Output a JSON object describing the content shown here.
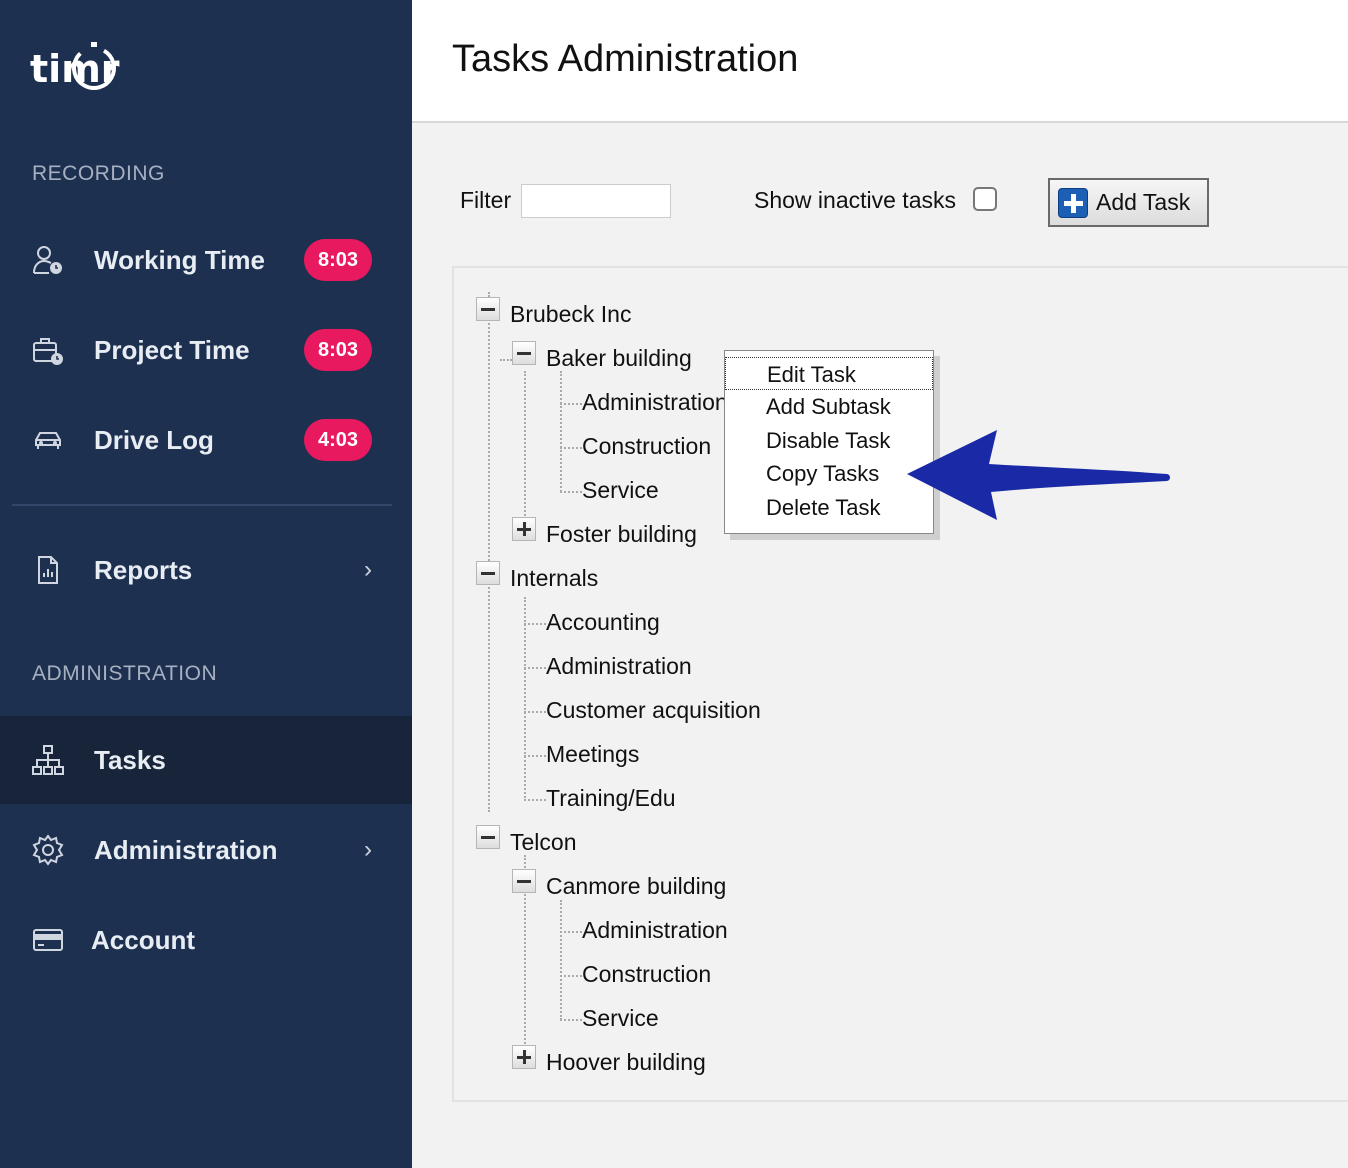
{
  "sidebar": {
    "logo": "timr",
    "recording_label": "RECORDING",
    "admin_label": "ADMINISTRATION",
    "items": [
      {
        "label": "Working Time",
        "badge": "8:03",
        "icon": "user-clock-icon"
      },
      {
        "label": "Project Time",
        "badge": "8:03",
        "icon": "briefcase-clock-icon"
      },
      {
        "label": "Drive Log",
        "badge": "4:03",
        "icon": "car-icon"
      },
      {
        "label": "Reports",
        "icon": "report-icon"
      },
      {
        "label": "Tasks",
        "icon": "hierarchy-icon",
        "active": true
      },
      {
        "label": "Administration",
        "icon": "gear-icon"
      },
      {
        "label": "Account",
        "icon": "card-icon"
      }
    ]
  },
  "header": {
    "title": "Tasks Administration"
  },
  "toolbar": {
    "filter_label": "Filter",
    "filter_value": "",
    "inactive_label": "Show inactive tasks",
    "inactive_checked": false,
    "add_task_label": "Add Task"
  },
  "tree": {
    "brubeck": "Brubeck Inc",
    "baker": "Baker building",
    "baker_admin": "Administration",
    "baker_construction": "Construction",
    "baker_service": "Service",
    "foster": "Foster building",
    "internals": "Internals",
    "accounting": "Accounting",
    "int_admin": "Administration",
    "customer": "Customer acquisition",
    "meetings": "Meetings",
    "training": "Training/Edu",
    "telcon": "Telcon",
    "canmore": "Canmore building",
    "canmore_admin": "Administration",
    "canmore_construction": "Construction",
    "canmore_service": "Service",
    "hoover": "Hoover building"
  },
  "context_menu": {
    "items": [
      "Edit Task",
      "Add Subtask",
      "Disable Task",
      "Copy Tasks",
      "Delete Task"
    ]
  },
  "colors": {
    "sidebar_bg": "#1e3050",
    "active_bg": "#17243a",
    "badge": "#e8195e",
    "arrow": "#1a2aa6"
  }
}
